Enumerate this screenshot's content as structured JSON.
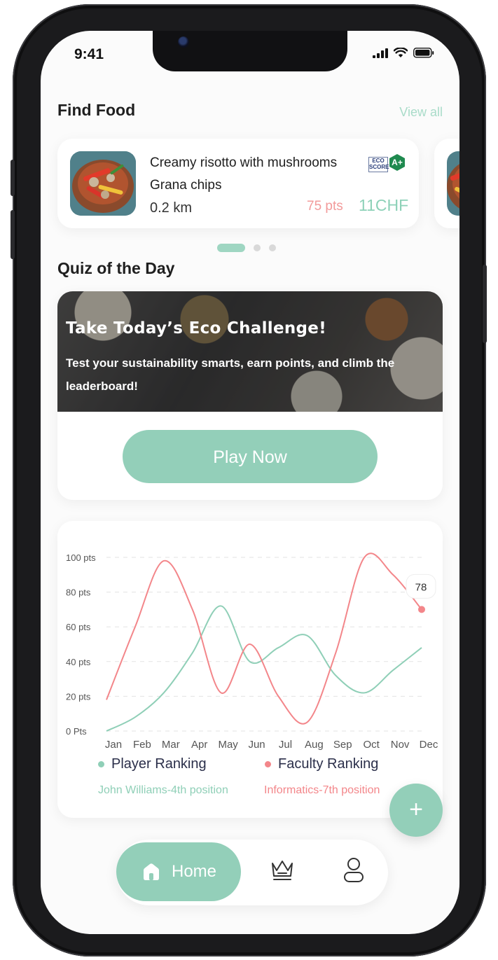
{
  "status": {
    "time": "9:41"
  },
  "find_food": {
    "title": "Find Food",
    "view_all": "View all",
    "card": {
      "name": "Creamy risotto with mushrooms",
      "subtitle": "Grana chips",
      "distance": "0.2 km",
      "points": "75 pts",
      "price": "11CHF",
      "eco_badge": "ECO SCORE",
      "eco_grade": "A+"
    },
    "carousel": {
      "pages": 3,
      "active": 0
    }
  },
  "quiz": {
    "section_title": "Quiz of the Day",
    "title": "Take Today’s Eco Challenge!",
    "text": "Test your sustainability smarts, earn points, and climb the leaderboard!",
    "button": "Play Now"
  },
  "chart_data": {
    "type": "line",
    "categories": [
      "Jan",
      "Feb",
      "Mar",
      "Apr",
      "May",
      "Jun",
      "Jul",
      "Aug",
      "Sep",
      "Oct",
      "Nov",
      "Dec"
    ],
    "y_ticks": [
      "100 pts",
      "80 pts",
      "60 pts",
      "40 pts",
      "20 pts",
      "0 Pts"
    ],
    "ylim": [
      0,
      100
    ],
    "grid": true,
    "series": [
      {
        "name": "Player Ranking",
        "color": "#8fcfb7",
        "values": [
          0,
          8,
          22,
          45,
          72,
          40,
          48,
          55,
          32,
          22,
          35,
          48
        ]
      },
      {
        "name": "Faculty Ranking",
        "color": "#f3868a",
        "values": [
          18,
          60,
          98,
          70,
          22,
          50,
          20,
          5,
          45,
          100,
          90,
          70
        ]
      }
    ],
    "tooltip": {
      "series": "Faculty Ranking",
      "category": "Dec",
      "label": "78"
    }
  },
  "legend": {
    "player": {
      "label": "Player Ranking",
      "sub": "John Williams-4th position",
      "color": "#8fcfb7"
    },
    "faculty": {
      "label": "Faculty Ranking",
      "sub": "Informatics-7th position",
      "color": "#f3868a"
    }
  },
  "fab": {
    "icon": "+"
  },
  "tabbar": {
    "home_label": "Home",
    "home_icon": "home-icon",
    "rank_icon": "crown-icon",
    "profile_icon": "user-icon"
  }
}
